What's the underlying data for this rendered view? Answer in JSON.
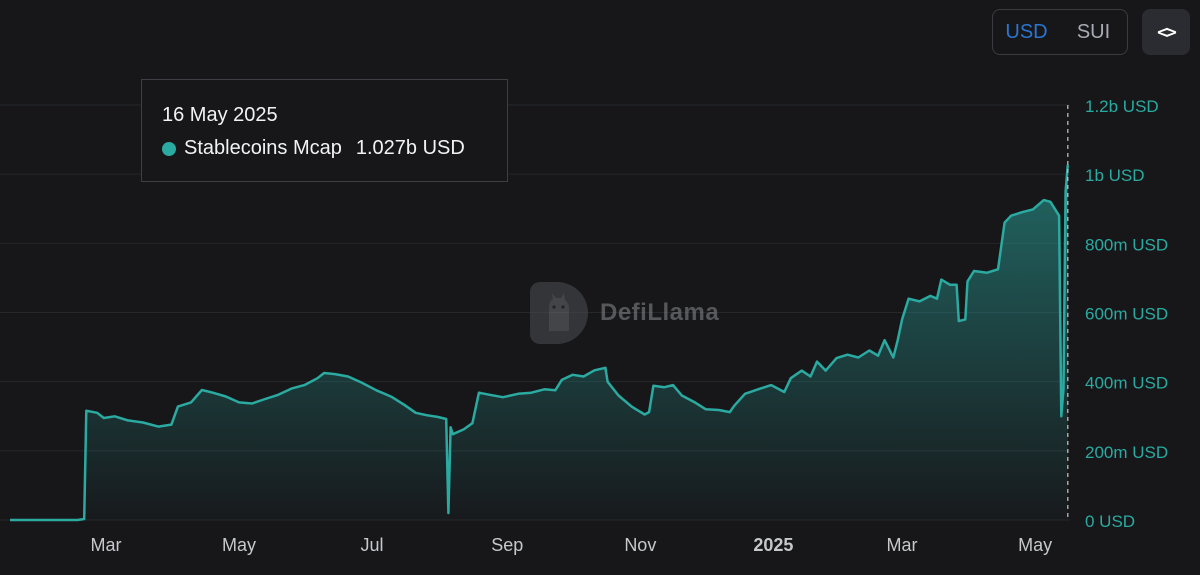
{
  "controls": {
    "currency_options": [
      "USD",
      "SUI"
    ],
    "selected_currency": "USD",
    "embed_icon": "code-brackets-icon"
  },
  "tooltip": {
    "date": "16 May 2025",
    "series_name": "Stablecoins Mcap",
    "value": "1.027b USD"
  },
  "watermark": {
    "text": "DefiLlama",
    "icon": "llama-logo-icon"
  },
  "colors": {
    "background": "#17171a",
    "series": "#2aaaa0",
    "axis_text": "#c6c8cc",
    "y_tick_text": "#2aaaa0",
    "grid": "#26272b",
    "active_toggle": "#2a75d0"
  },
  "chart_data": {
    "type": "area",
    "x_ticks": [
      {
        "label": "Mar",
        "date": "2024-03-01",
        "bold": false
      },
      {
        "label": "May",
        "date": "2024-05-01",
        "bold": false
      },
      {
        "label": "Jul",
        "date": "2024-07-01",
        "bold": false
      },
      {
        "label": "Sep",
        "date": "2024-09-01",
        "bold": false
      },
      {
        "label": "Nov",
        "date": "2024-11-01",
        "bold": false
      },
      {
        "label": "2025",
        "date": "2025-01-01",
        "bold": true
      },
      {
        "label": "Mar",
        "date": "2025-03-01",
        "bold": false
      },
      {
        "label": "May",
        "date": "2025-05-01",
        "bold": false
      }
    ],
    "y_ticks": [
      {
        "label": "0 USD",
        "value": 0
      },
      {
        "label": "200m USD",
        "value": 200
      },
      {
        "label": "400m USD",
        "value": 400
      },
      {
        "label": "600m USD",
        "value": 600
      },
      {
        "label": "800m USD",
        "value": 800
      },
      {
        "label": "1b USD",
        "value": 1000
      },
      {
        "label": "1.2b USD",
        "value": 1200
      }
    ],
    "y_unit": "m USD",
    "ylim": [
      0,
      1200
    ],
    "x_range": [
      "2024-01-17",
      "2025-05-17"
    ],
    "grid": true,
    "crosshair_date": "2025-05-16",
    "series": [
      {
        "name": "Stablecoins Mcap",
        "points": [
          [
            "2024-01-17",
            0
          ],
          [
            "2024-02-17",
            0
          ],
          [
            "2024-02-20",
            3
          ],
          [
            "2024-02-21",
            316
          ],
          [
            "2024-02-26",
            310
          ],
          [
            "2024-02-29",
            295
          ],
          [
            "2024-03-05",
            300
          ],
          [
            "2024-03-11",
            288
          ],
          [
            "2024-03-18",
            282
          ],
          [
            "2024-03-25",
            270
          ],
          [
            "2024-03-31",
            276
          ],
          [
            "2024-04-03",
            328
          ],
          [
            "2024-04-09",
            340
          ],
          [
            "2024-04-14",
            376
          ],
          [
            "2024-04-19",
            368
          ],
          [
            "2024-04-25",
            357
          ],
          [
            "2024-05-01",
            340
          ],
          [
            "2024-05-07",
            337
          ],
          [
            "2024-05-13",
            350
          ],
          [
            "2024-05-19",
            362
          ],
          [
            "2024-05-25",
            380
          ],
          [
            "2024-05-31",
            390
          ],
          [
            "2024-06-06",
            410
          ],
          [
            "2024-06-09",
            425
          ],
          [
            "2024-06-14",
            422
          ],
          [
            "2024-06-20",
            415
          ],
          [
            "2024-06-26",
            398
          ],
          [
            "2024-07-03",
            375
          ],
          [
            "2024-07-10",
            356
          ],
          [
            "2024-07-16",
            332
          ],
          [
            "2024-07-21",
            310
          ],
          [
            "2024-07-26",
            303
          ],
          [
            "2024-07-31",
            298
          ],
          [
            "2024-08-04",
            292
          ],
          [
            "2024-08-05",
            20
          ],
          [
            "2024-08-06",
            268
          ],
          [
            "2024-08-07",
            248
          ],
          [
            "2024-08-12",
            262
          ],
          [
            "2024-08-16",
            280
          ],
          [
            "2024-08-19",
            368
          ],
          [
            "2024-08-24",
            362
          ],
          [
            "2024-08-30",
            355
          ],
          [
            "2024-09-06",
            365
          ],
          [
            "2024-09-12",
            368
          ],
          [
            "2024-09-18",
            378
          ],
          [
            "2024-09-23",
            375
          ],
          [
            "2024-09-26",
            405
          ],
          [
            "2024-10-01",
            420
          ],
          [
            "2024-10-06",
            415
          ],
          [
            "2024-10-11",
            433
          ],
          [
            "2024-10-16",
            440
          ],
          [
            "2024-10-17",
            400
          ],
          [
            "2024-10-22",
            360
          ],
          [
            "2024-10-28",
            328
          ],
          [
            "2024-11-03",
            305
          ],
          [
            "2024-11-05",
            312
          ],
          [
            "2024-11-07",
            388
          ],
          [
            "2024-11-12",
            384
          ],
          [
            "2024-11-16",
            390
          ],
          [
            "2024-11-20",
            360
          ],
          [
            "2024-11-26",
            340
          ],
          [
            "2024-12-01",
            320
          ],
          [
            "2024-12-07",
            318
          ],
          [
            "2024-12-12",
            312
          ],
          [
            "2024-12-14",
            330
          ],
          [
            "2024-12-19",
            365
          ],
          [
            "2024-12-25",
            378
          ],
          [
            "2024-12-31",
            390
          ],
          [
            "2025-01-06",
            370
          ],
          [
            "2025-01-09",
            410
          ],
          [
            "2025-01-14",
            432
          ],
          [
            "2025-01-18",
            415
          ],
          [
            "2025-01-21",
            458
          ],
          [
            "2025-01-25",
            432
          ],
          [
            "2025-01-30",
            468
          ],
          [
            "2025-02-04",
            478
          ],
          [
            "2025-02-09",
            470
          ],
          [
            "2025-02-14",
            490
          ],
          [
            "2025-02-18",
            475
          ],
          [
            "2025-02-21",
            520
          ],
          [
            "2025-02-25",
            470
          ],
          [
            "2025-02-27",
            520
          ],
          [
            "2025-03-01",
            580
          ],
          [
            "2025-03-04",
            640
          ],
          [
            "2025-03-09",
            632
          ],
          [
            "2025-03-14",
            648
          ],
          [
            "2025-03-17",
            640
          ],
          [
            "2025-03-19",
            695
          ],
          [
            "2025-03-23",
            680
          ],
          [
            "2025-03-26",
            680
          ],
          [
            "2025-03-27",
            575
          ],
          [
            "2025-03-30",
            580
          ],
          [
            "2025-03-31",
            690
          ],
          [
            "2025-04-03",
            720
          ],
          [
            "2025-04-09",
            715
          ],
          [
            "2025-04-14",
            725
          ],
          [
            "2025-04-17",
            860
          ],
          [
            "2025-04-20",
            880
          ],
          [
            "2025-04-25",
            890
          ],
          [
            "2025-04-30",
            898
          ],
          [
            "2025-05-05",
            925
          ],
          [
            "2025-05-08",
            920
          ],
          [
            "2025-05-11",
            890
          ],
          [
            "2025-05-12",
            880
          ],
          [
            "2025-05-13",
            300
          ],
          [
            "2025-05-14",
            380
          ],
          [
            "2025-05-15",
            950
          ],
          [
            "2025-05-16",
            1027
          ]
        ]
      }
    ]
  }
}
